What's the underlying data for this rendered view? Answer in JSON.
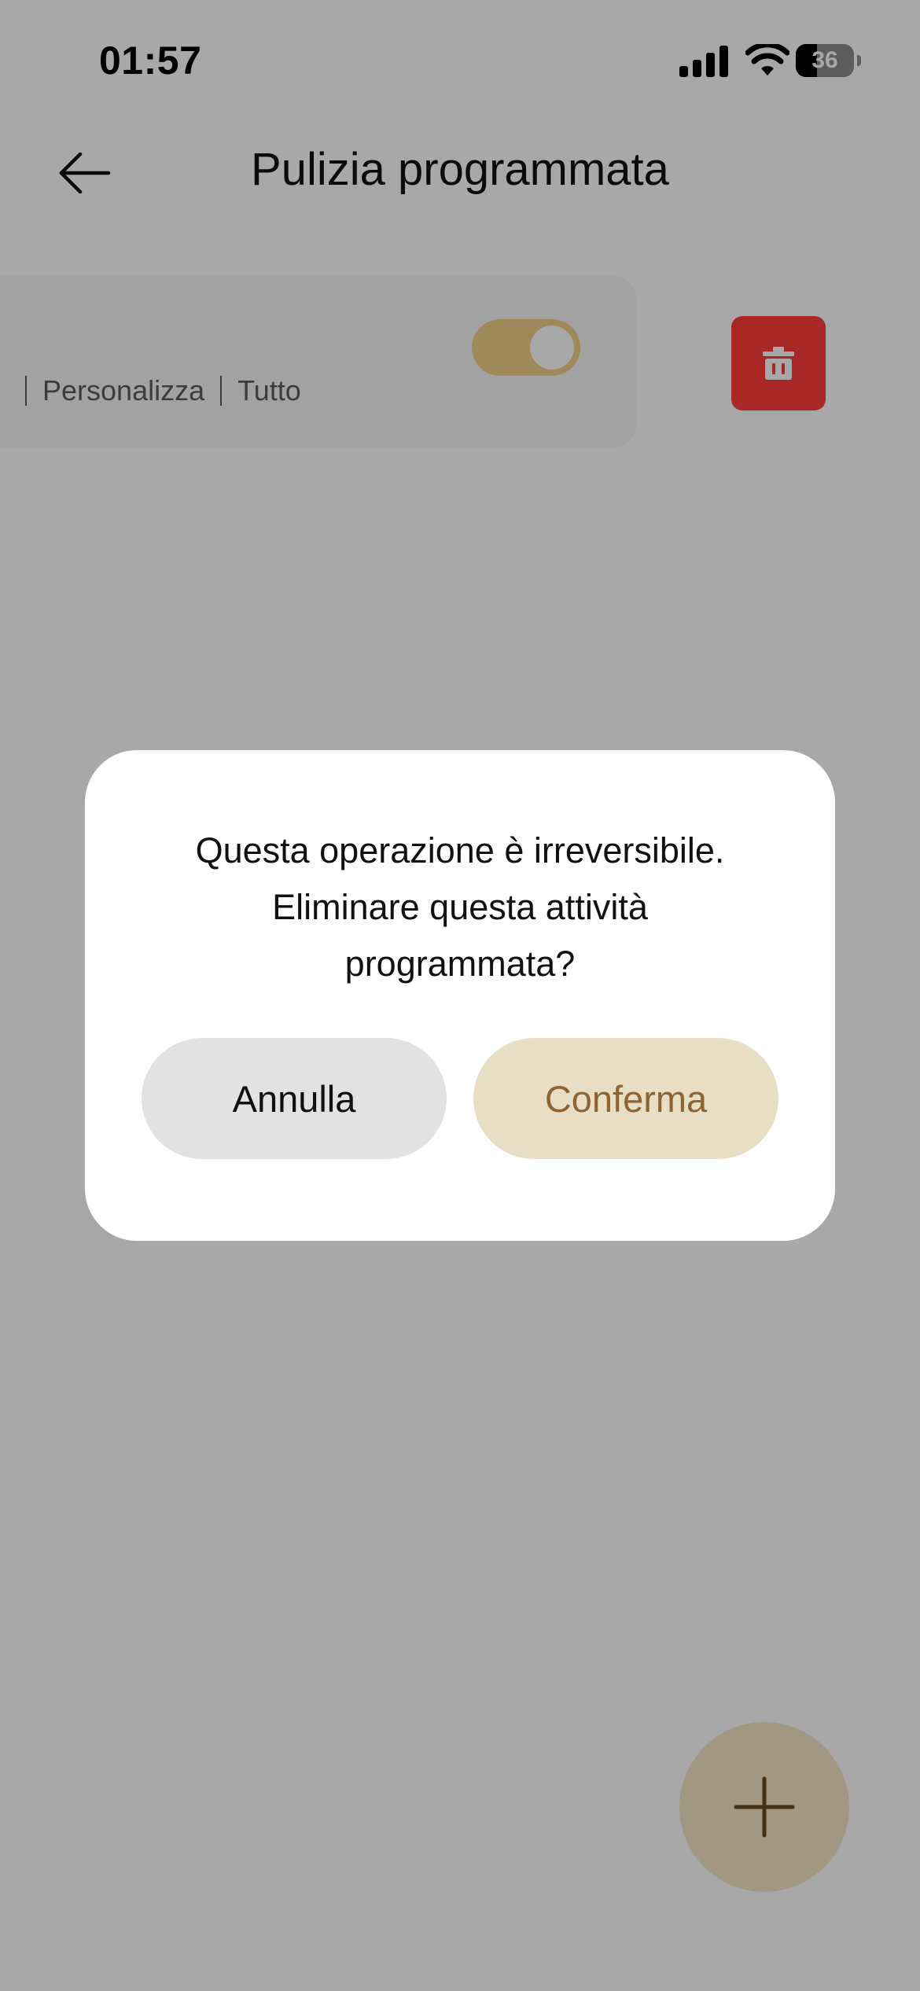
{
  "status_bar": {
    "time": "01:57",
    "battery_level": "36"
  },
  "header": {
    "title": "Pulizia programmata"
  },
  "task_card": {
    "tags": [
      "Personalizza",
      "Tutto"
    ],
    "enabled": true
  },
  "dialog": {
    "message_lines": [
      "Questa operazione è irreversibile.",
      "Eliminare questa attività",
      "programmata?"
    ],
    "cancel_label": "Annulla",
    "confirm_label": "Conferma"
  },
  "colors": {
    "accent": "#8d6432",
    "toggle_on": "#f2cf88",
    "delete": "#ff3e3e"
  },
  "icons": {
    "back": "arrow-left-icon",
    "delete": "trash-icon",
    "add": "plus-icon"
  }
}
